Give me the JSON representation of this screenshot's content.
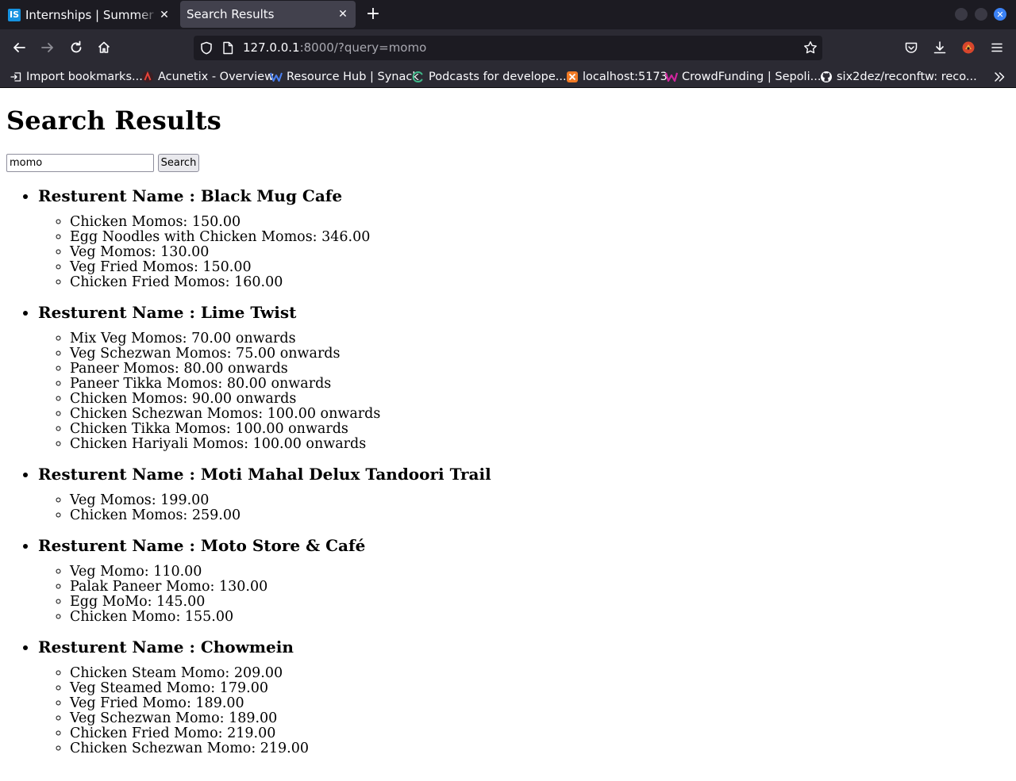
{
  "browser": {
    "tabs": [
      {
        "favicon": "IS",
        "title": "Internships | Summer Internships",
        "active": false
      },
      {
        "title": "Search Results",
        "active": true
      }
    ],
    "url_host": "127.0.0.1",
    "url_rest": ":8000/?query=momo",
    "bookmarks": [
      {
        "icon": "import-icon",
        "label": "Import bookmarks..."
      },
      {
        "icon": "acunetix-icon",
        "label": "Acunetix - Overview"
      },
      {
        "icon": "synack-icon",
        "label": "Resource Hub | Synack"
      },
      {
        "icon": "podcast-icon",
        "label": "Podcasts for develope..."
      },
      {
        "icon": "xampp-icon",
        "label": "localhost:5173"
      },
      {
        "icon": "crowdfunding-icon",
        "label": "CrowdFunding | Sepoli..."
      },
      {
        "icon": "github-icon",
        "label": "six2dez/reconftw: reco..."
      }
    ]
  },
  "page": {
    "title": "Search Results",
    "search": {
      "value": "momo",
      "button_label": "Search"
    },
    "restaurant_label_prefix": "Resturent Name : ",
    "restaurants": [
      {
        "name": "Black Mug Cafe",
        "dishes": [
          "Chicken Momos: 150.00",
          "Egg Noodles with Chicken Momos: 346.00",
          "Veg Momos: 130.00",
          "Veg Fried Momos: 150.00",
          "Chicken Fried Momos: 160.00"
        ]
      },
      {
        "name": "Lime Twist",
        "dishes": [
          "Mix Veg Momos: 70.00 onwards",
          "Veg Schezwan Momos: 75.00 onwards",
          "Paneer Momos: 80.00 onwards",
          "Paneer Tikka Momos: 80.00 onwards",
          "Chicken Momos: 90.00 onwards",
          "Chicken Schezwan Momos: 100.00 onwards",
          "Chicken Tikka Momos: 100.00 onwards",
          "Chicken Hariyali Momos: 100.00 onwards"
        ]
      },
      {
        "name": "Moti Mahal Delux Tandoori Trail",
        "dishes": [
          "Veg Momos: 199.00",
          "Chicken Momos: 259.00"
        ]
      },
      {
        "name": "Moto Store & Café",
        "dishes": [
          "Veg Momo: 110.00",
          "Palak Paneer Momo: 130.00",
          "Egg MoMo: 145.00",
          "Chicken Momo: 155.00"
        ]
      },
      {
        "name": "Chowmein",
        "dishes": [
          "Chicken Steam Momo: 209.00",
          "Veg Steamed Momo: 179.00",
          "Veg Fried Momo: 189.00",
          "Veg Schezwan Momo: 189.00",
          "Chicken Fried Momo: 219.00",
          "Chicken Schezwan Momo: 219.00"
        ]
      }
    ]
  }
}
